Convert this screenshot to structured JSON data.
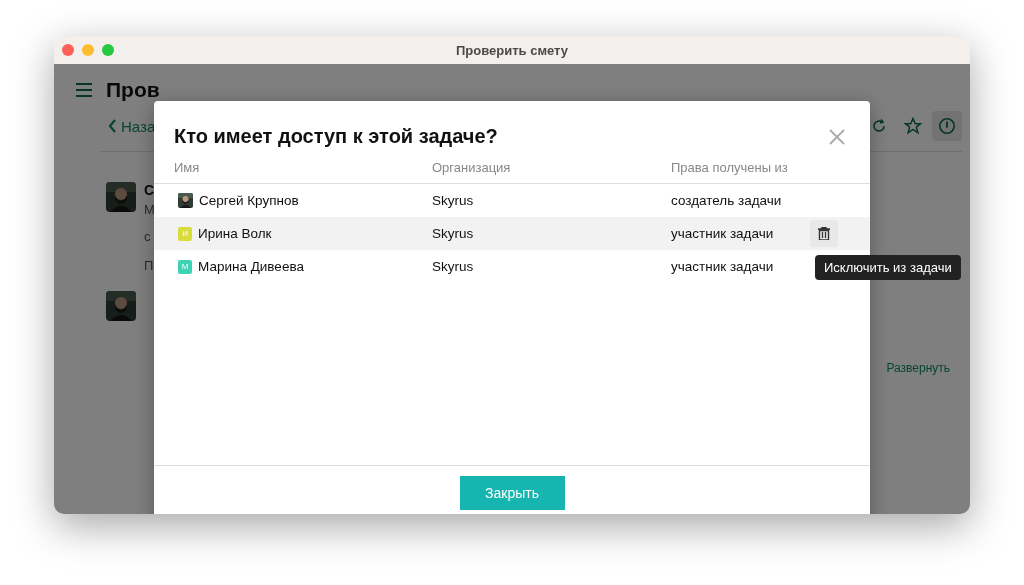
{
  "window": {
    "title": "Проверить смету"
  },
  "background": {
    "page_title": "Пров",
    "back_link": "Наза",
    "comment_lines": [
      "С",
      "М",
      "с",
      "П"
    ],
    "expand_link": "Развернуть",
    "toolbar": [
      {
        "kind": "refresh",
        "selected": false
      },
      {
        "kind": "star",
        "selected": false
      },
      {
        "kind": "info",
        "selected": true
      }
    ]
  },
  "dialog": {
    "title": "Кто имеет доступ к этой задаче?",
    "columns": [
      "Имя",
      "Организация",
      "Права получены из"
    ],
    "rows": [
      {
        "name": "Сергей Крупнов",
        "organization": "Skyrus",
        "rights_source": "создатель задачи",
        "hovered": false
      },
      {
        "name": "Ирина Волк",
        "avatar": {
          "kind": "letter",
          "letter": "И",
          "color": "#d9dd3c"
        },
        "organization": "Skyrus",
        "rights_source": "участник задачи",
        "hovered": true
      },
      {
        "name": "Марина Дивеева",
        "avatar": {
          "kind": "letter",
          "letter": "М",
          "color": "#3ed3b4"
        },
        "organization": "Skyrus",
        "rights_source": "участник задачи",
        "hovered": false
      }
    ],
    "remove_tooltip": "Исключить из задачи",
    "close_button": "Закрыть"
  }
}
